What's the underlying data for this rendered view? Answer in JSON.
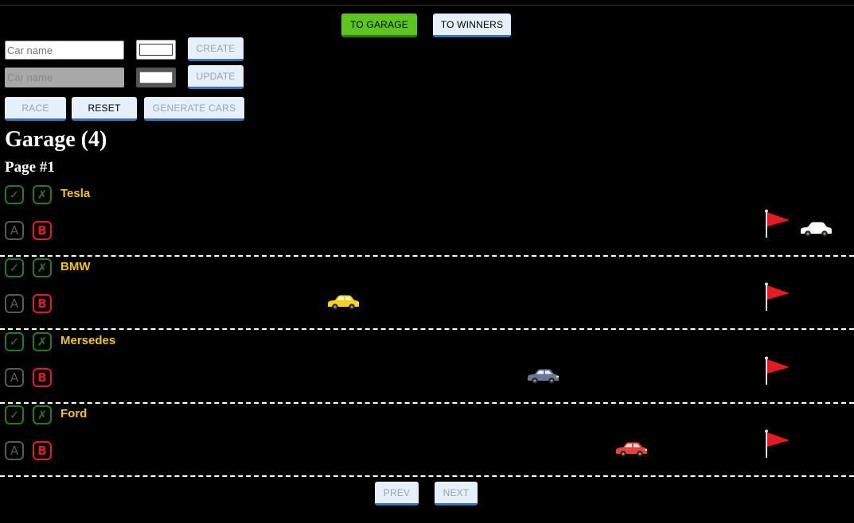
{
  "nav": {
    "garage_label": "To garage",
    "winners_label": "To winners"
  },
  "create": {
    "placeholder": "Car name",
    "button_label": "Create"
  },
  "update": {
    "placeholder": "Car name",
    "button_label": "Update"
  },
  "controls": {
    "race_label": "Race",
    "reset_label": "Reset",
    "generate_label": "Generate cars"
  },
  "garage": {
    "title": "Garage (4)",
    "page": "Page #1"
  },
  "icons": {
    "select": "✓",
    "remove": "✗",
    "start": "A",
    "stop": "B"
  },
  "cars": [
    {
      "name": "Tesla",
      "color": "#ffffff",
      "progress": 1.0
    },
    {
      "name": "BMW",
      "color": "#f5d21f",
      "progress": 0.36
    },
    {
      "name": "Mersedes",
      "color": "#6b7796",
      "progress": 0.63
    },
    {
      "name": "Ford",
      "color": "#e8413e",
      "progress": 0.75
    }
  ],
  "pagination": {
    "prev_label": "Prev",
    "next_label": "Next"
  },
  "colors": {
    "accent_green": "#5cc51f",
    "flag_red": "#e51b23",
    "name_yellow": "#f0c419"
  }
}
